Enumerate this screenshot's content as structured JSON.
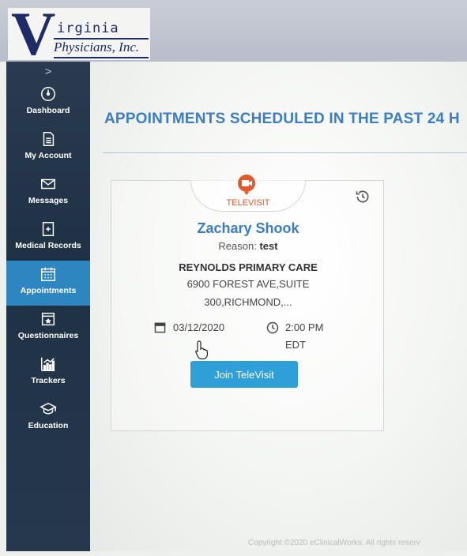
{
  "logo": {
    "letter": "V",
    "line1": "irginia",
    "line2": "Physicians, Inc."
  },
  "sidebar": {
    "expand_glyph": ">",
    "items": [
      {
        "label": "Dashboard",
        "icon": "dashboard-gauge-icon"
      },
      {
        "label": "My Account",
        "icon": "document-icon"
      },
      {
        "label": "Messages",
        "icon": "envelope-icon"
      },
      {
        "label": "Medical Records",
        "icon": "records-icon"
      },
      {
        "label": "Appointments",
        "icon": "calendar-icon",
        "active": true
      },
      {
        "label": "Questionnaires",
        "icon": "questionnaire-icon"
      },
      {
        "label": "Trackers",
        "icon": "chart-icon"
      },
      {
        "label": "Education",
        "icon": "graduation-cap-icon"
      }
    ],
    "active_color": "#2e86c1"
  },
  "main": {
    "title": "APPOINTMENTS SCHEDULED IN THE PAST 24 H",
    "title_color": "#3b7dc4"
  },
  "appointment": {
    "type_label": "TELEVISIT",
    "type_color": "#d9572a",
    "patient_name": "Zachary Shook",
    "reason_label": "Reason:",
    "reason_value": "test",
    "practice": "REYNOLDS PRIMARY CARE",
    "address_line1": "6900 FOREST AVE,SUITE",
    "address_line2": "300,RICHMOND,...",
    "date": "03/12/2020",
    "time": "2:00 PM",
    "timezone": "EDT",
    "join_label": "Join TeleVisit",
    "join_color": "#2f9fd8"
  },
  "footer": {
    "text": "Copyright ©2020 eClinicalWorks. All rights reserv"
  }
}
